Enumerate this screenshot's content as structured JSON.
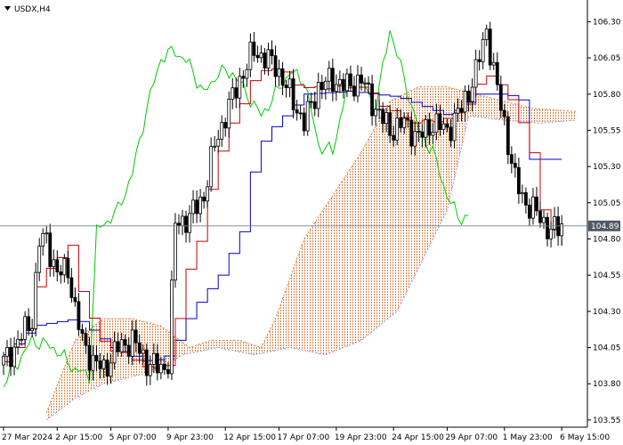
{
  "chart_data": {
    "type": "candlestick",
    "symbol_label": "USDX,H4",
    "current_price": 104.89,
    "current_price_label": "104.89",
    "ylim": [
      103.5,
      106.45
    ],
    "y_ticks": [
      {
        "value": 106.3,
        "label": "106.30"
      },
      {
        "value": 106.05,
        "label": "106.05"
      },
      {
        "value": 105.8,
        "label": "105.80"
      },
      {
        "value": 105.55,
        "label": "105.55"
      },
      {
        "value": 105.3,
        "label": "105.30"
      },
      {
        "value": 105.05,
        "label": "105.05"
      },
      {
        "value": 104.8,
        "label": "104.80"
      },
      {
        "value": 104.55,
        "label": "104.55"
      },
      {
        "value": 104.3,
        "label": "104.30"
      },
      {
        "value": 104.05,
        "label": "104.05"
      },
      {
        "value": 103.8,
        "label": "103.80"
      },
      {
        "value": 103.55,
        "label": "103.55"
      }
    ],
    "x_ticks": [
      {
        "index": 0,
        "label": "27 Mar 2024"
      },
      {
        "index": 15,
        "label": "2 Apr 15:00"
      },
      {
        "index": 30,
        "label": "5 Apr 07:00"
      },
      {
        "index": 46,
        "label": "9 Apr 23:00"
      },
      {
        "index": 62,
        "label": "12 Apr 15:00"
      },
      {
        "index": 77,
        "label": "17 Apr 07:00"
      },
      {
        "index": 93,
        "label": "19 Apr 23:00"
      },
      {
        "index": 109,
        "label": "24 Apr 15:00"
      },
      {
        "index": 124,
        "label": "29 Apr 07:00"
      },
      {
        "index": 140,
        "label": "1 May 23:00"
      },
      {
        "index": 156,
        "label": "6 May 15:00"
      }
    ],
    "close_keypoints": [
      [
        0,
        103.95
      ],
      [
        3,
        104.05
      ],
      [
        8,
        104.25
      ],
      [
        10,
        104.78
      ],
      [
        12,
        104.8
      ],
      [
        15,
        104.55
      ],
      [
        18,
        104.6
      ],
      [
        20,
        104.3
      ],
      [
        22,
        104.1
      ],
      [
        25,
        103.95
      ],
      [
        28,
        103.9
      ],
      [
        32,
        104.05
      ],
      [
        36,
        104.1
      ],
      [
        40,
        103.95
      ],
      [
        44,
        103.9
      ],
      [
        46,
        103.95
      ],
      [
        48,
        104.9
      ],
      [
        52,
        104.95
      ],
      [
        56,
        105.1
      ],
      [
        59,
        105.45
      ],
      [
        62,
        105.65
      ],
      [
        66,
        105.9
      ],
      [
        70,
        106.1
      ],
      [
        73,
        106.05
      ],
      [
        76,
        106.0
      ],
      [
        80,
        105.8
      ],
      [
        84,
        105.6
      ],
      [
        88,
        105.85
      ],
      [
        92,
        105.9
      ],
      [
        96,
        105.85
      ],
      [
        100,
        105.9
      ],
      [
        104,
        105.7
      ],
      [
        108,
        105.55
      ],
      [
        112,
        105.6
      ],
      [
        116,
        105.5
      ],
      [
        120,
        105.6
      ],
      [
        124,
        105.55
      ],
      [
        128,
        105.7
      ],
      [
        132,
        105.95
      ],
      [
        135,
        106.25
      ],
      [
        137,
        105.95
      ],
      [
        140,
        105.6
      ],
      [
        143,
        105.2
      ],
      [
        146,
        105.05
      ],
      [
        150,
        104.95
      ],
      [
        153,
        104.85
      ],
      [
        156,
        104.89
      ]
    ],
    "line_keypoints": {
      "tenkan": [
        [
          0,
          103.95
        ],
        [
          5,
          104.1
        ],
        [
          10,
          104.55
        ],
        [
          18,
          104.75
        ],
        [
          22,
          104.35
        ],
        [
          28,
          104.05
        ],
        [
          35,
          104.0
        ],
        [
          40,
          103.9
        ],
        [
          46,
          103.95
        ],
        [
          50,
          104.55
        ],
        [
          55,
          104.85
        ],
        [
          58,
          105.3
        ],
        [
          62,
          105.55
        ],
        [
          66,
          105.75
        ],
        [
          70,
          105.95
        ],
        [
          76,
          106.0
        ],
        [
          82,
          105.85
        ],
        [
          90,
          105.85
        ],
        [
          100,
          105.85
        ],
        [
          106,
          105.7
        ],
        [
          114,
          105.6
        ],
        [
          124,
          105.62
        ],
        [
          130,
          105.75
        ],
        [
          134,
          105.95
        ],
        [
          140,
          105.8
        ],
        [
          146,
          105.5
        ],
        [
          150,
          105.0
        ],
        [
          153,
          104.85
        ],
        [
          156,
          104.75
        ]
      ],
      "kijun": [
        [
          0,
          104.0
        ],
        [
          8,
          104.2
        ],
        [
          20,
          104.25
        ],
        [
          30,
          104.05
        ],
        [
          40,
          103.95
        ],
        [
          46,
          104.0
        ],
        [
          52,
          104.3
        ],
        [
          60,
          104.55
        ],
        [
          66,
          104.85
        ],
        [
          70,
          105.4
        ],
        [
          74,
          105.55
        ],
        [
          84,
          105.8
        ],
        [
          96,
          105.82
        ],
        [
          110,
          105.78
        ],
        [
          124,
          105.65
        ],
        [
          132,
          105.8
        ],
        [
          140,
          105.8
        ],
        [
          145,
          105.75
        ],
        [
          147,
          105.35
        ],
        [
          156,
          105.35
        ]
      ],
      "chikou": [
        [
          0,
          103.8
        ],
        [
          8,
          104.1
        ],
        [
          14,
          104.05
        ],
        [
          20,
          103.9
        ],
        [
          24,
          103.85
        ],
        [
          26,
          104.85
        ],
        [
          32,
          105.0
        ],
        [
          36,
          105.25
        ],
        [
          40,
          105.7
        ],
        [
          44,
          106.05
        ],
        [
          48,
          106.1
        ],
        [
          52,
          106.0
        ],
        [
          56,
          105.8
        ],
        [
          60,
          105.95
        ],
        [
          64,
          105.95
        ],
        [
          68,
          105.8
        ],
        [
          72,
          105.65
        ],
        [
          76,
          105.8
        ],
        [
          80,
          105.95
        ],
        [
          84,
          105.9
        ],
        [
          88,
          105.45
        ],
        [
          92,
          105.4
        ],
        [
          96,
          105.85
        ],
        [
          100,
          105.9
        ],
        [
          104,
          105.7
        ],
        [
          108,
          106.25
        ],
        [
          112,
          105.9
        ],
        [
          116,
          105.55
        ],
        [
          120,
          105.4
        ],
        [
          124,
          105.1
        ],
        [
          127,
          104.95
        ],
        [
          130,
          104.95
        ]
      ],
      "span_a": [
        [
          12,
          103.6
        ],
        [
          20,
          104.1
        ],
        [
          28,
          104.25
        ],
        [
          36,
          104.25
        ],
        [
          44,
          104.2
        ],
        [
          52,
          104.05
        ],
        [
          58,
          104.1
        ],
        [
          66,
          104.1
        ],
        [
          72,
          104.05
        ],
        [
          76,
          104.25
        ],
        [
          84,
          104.8
        ],
        [
          92,
          105.1
        ],
        [
          100,
          105.4
        ],
        [
          108,
          105.75
        ],
        [
          116,
          105.85
        ],
        [
          124,
          105.85
        ],
        [
          132,
          105.8
        ],
        [
          140,
          105.75
        ],
        [
          148,
          105.7
        ],
        [
          160,
          105.68
        ]
      ],
      "span_b": [
        [
          12,
          103.55
        ],
        [
          20,
          103.7
        ],
        [
          28,
          103.8
        ],
        [
          36,
          103.85
        ],
        [
          44,
          103.9
        ],
        [
          50,
          104.0
        ],
        [
          60,
          104.05
        ],
        [
          70,
          104.0
        ],
        [
          80,
          104.05
        ],
        [
          90,
          104.0
        ],
        [
          100,
          104.1
        ],
        [
          110,
          104.3
        ],
        [
          120,
          104.8
        ],
        [
          124,
          105.0
        ],
        [
          130,
          105.65
        ],
        [
          140,
          105.62
        ],
        [
          150,
          105.6
        ],
        [
          160,
          105.62
        ]
      ]
    },
    "colors": {
      "candle": "#000000",
      "tenkan": "#cc0000",
      "kijun": "#0000cc",
      "chikou": "#00cc00",
      "cloud_bull": "#e07b39",
      "cloud_bear": "#9b8fd8",
      "price_line": "#708090",
      "price_tag_bg": "#505a64",
      "axis": "#000000"
    },
    "grid": false
  }
}
